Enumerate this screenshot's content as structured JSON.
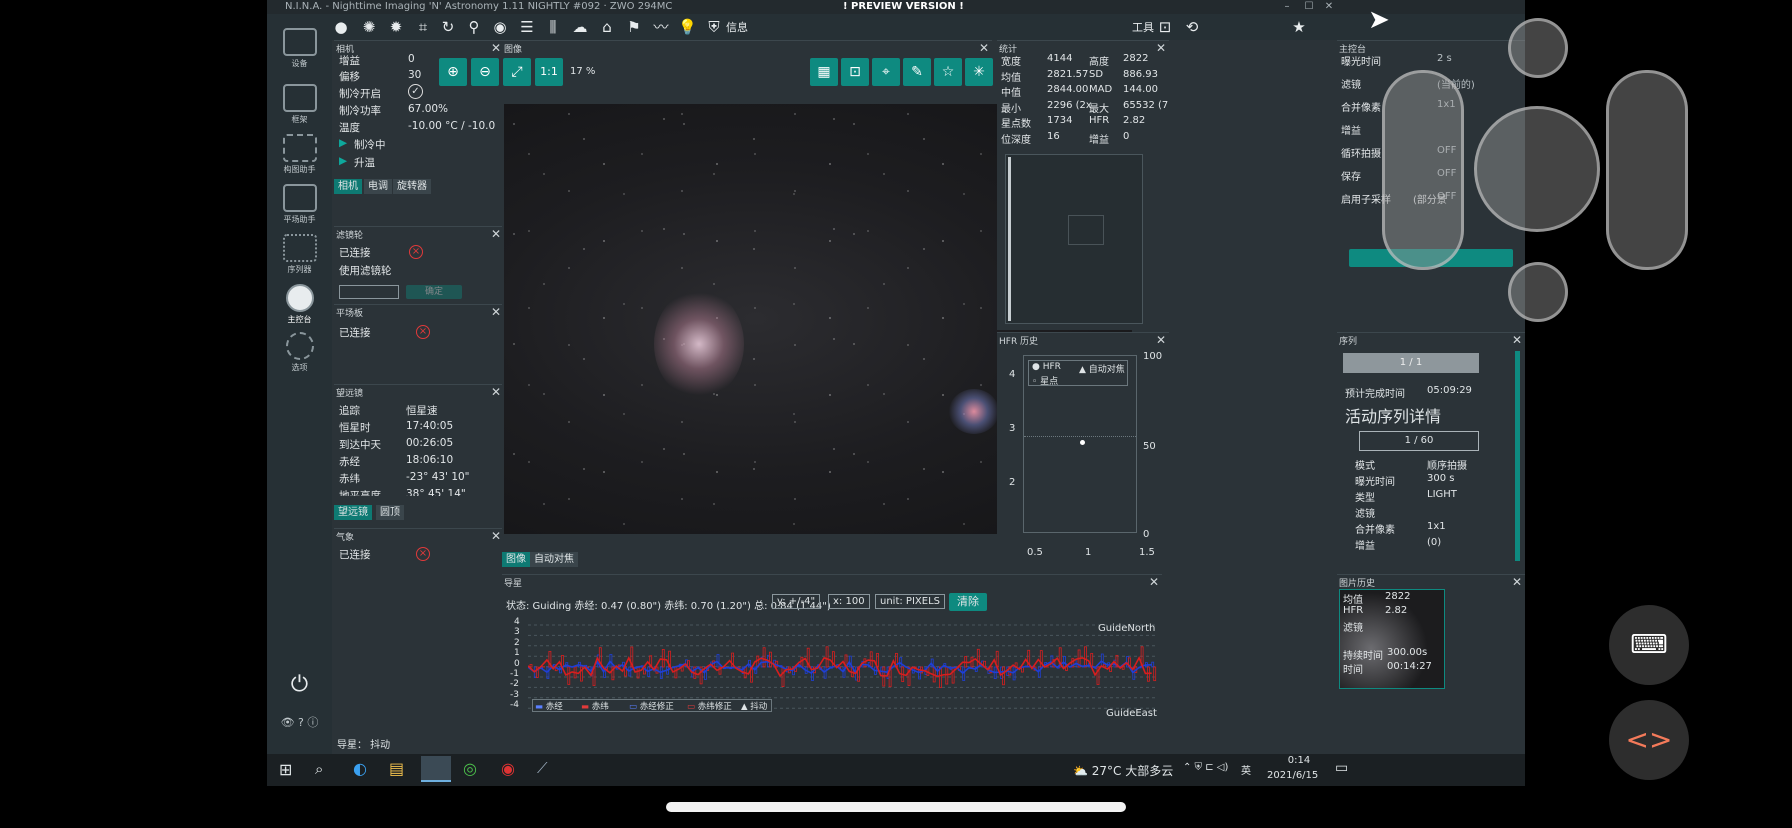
{
  "window": {
    "title": "N.I.N.A. - Nighttime Imaging 'N' Astronomy 1.11 NIGHTLY #092 · ZWO 294MC",
    "preview": "! PREVIEW VERSION !"
  },
  "toolbar": {
    "info_label": "信息",
    "tools_label": "工具"
  },
  "sidebar": [
    {
      "label": "设备"
    },
    {
      "label": "框架"
    },
    {
      "label": "构图助手"
    },
    {
      "label": "平场助手"
    },
    {
      "label": "序列器"
    },
    {
      "label": "主控台"
    },
    {
      "label": "选项"
    }
  ],
  "camera": {
    "title": "相机",
    "rows": [
      {
        "k": "增益",
        "v": "0"
      },
      {
        "k": "偏移",
        "v": "30"
      },
      {
        "k": "制冷开启",
        "v": "✓"
      },
      {
        "k": "制冷功率",
        "v": "67.00%"
      },
      {
        "k": "温度",
        "v": "-10.00 °C / -10.0"
      }
    ],
    "cooling": "制冷中",
    "warming": "升温",
    "tabs": [
      "相机",
      "电调",
      "旋转器"
    ]
  },
  "filterwheel": {
    "title": "滤镜轮",
    "connected": "已连接",
    "use": "使用滤镜轮",
    "btn": "确定"
  },
  "flatpanel": {
    "title": "平场板",
    "connected": "已连接"
  },
  "telescope": {
    "title": "望远镜",
    "rows": [
      {
        "k": "追踪",
        "v": "恒星速"
      },
      {
        "k": "恒星时",
        "v": "17:40:05"
      },
      {
        "k": "到达中天",
        "v": "00:26:05"
      },
      {
        "k": "赤经",
        "v": "18:06:10"
      },
      {
        "k": "赤纬",
        "v": "-23° 43' 10\""
      },
      {
        "k": "地平高度",
        "v": "38° 45' 14\""
      }
    ],
    "tabs": [
      "望远镜",
      "圆顶"
    ]
  },
  "weather": {
    "title": "气象",
    "connected": "已连接"
  },
  "image": {
    "title": "图像",
    "zoom": "17 %",
    "one": "1:1",
    "tabs": [
      "图像",
      "自动对焦"
    ]
  },
  "stats": {
    "title": "统计",
    "rows": [
      [
        "宽度",
        "4144",
        "高度",
        "2822"
      ],
      [
        "均值",
        "2821.57",
        "SD",
        "886.93"
      ],
      [
        "中值",
        "2844.00",
        "MAD",
        "144.00"
      ],
      [
        "最小",
        "2296 (2x",
        "最大",
        "65532 (7"
      ],
      [
        "星点数",
        "1734",
        "HFR",
        "2.82"
      ],
      [
        "位深度",
        "16",
        "增益",
        "0"
      ]
    ]
  },
  "imaging": {
    "title": "主控台",
    "rows": [
      {
        "k": "曝光时间",
        "v": "2 s"
      },
      {
        "k": "滤镜",
        "v": "(当前的)"
      },
      {
        "k": "合并像素",
        "v": "1x1"
      },
      {
        "k": "增益",
        "v": ""
      },
      {
        "k": "循环拍摄",
        "v": "OFF"
      },
      {
        "k": "保存",
        "v": "OFF"
      },
      {
        "k": "启用子采样",
        "v": "OFF"
      }
    ],
    "subsample_note": "(部分景"
  },
  "hfr": {
    "title": "HFR 历史",
    "legend": [
      "HFR",
      "自动对焦",
      "星点"
    ],
    "y_left": [
      "4",
      "3",
      "2"
    ],
    "y_right": [
      "100",
      "50",
      "0"
    ],
    "x": [
      "0.5",
      "1",
      "1.5"
    ]
  },
  "sequence": {
    "title": "序列",
    "progress": "1 / 1",
    "eta_label": "预计完成时间",
    "eta": "05:09:29",
    "detail_title": "活动序列详情",
    "count": "1 / 60",
    "rows": [
      {
        "k": "模式",
        "v": "顺序拍摄"
      },
      {
        "k": "曝光时间",
        "v": "300 s"
      },
      {
        "k": "类型",
        "v": "LIGHT"
      },
      {
        "k": "滤镜",
        "v": ""
      },
      {
        "k": "合并像素",
        "v": "1x1"
      },
      {
        "k": "增益",
        "v": "(0)"
      }
    ]
  },
  "guider": {
    "title": "导星",
    "status": "状态: Guiding 赤经: 0.47 (0.80\") 赤纬: 0.70 (1.20\") 总: 0.84 (1.44\")",
    "y_select": "y: +/-4\"",
    "x_select": "x: 100",
    "unit_select": "unit: PIXELS",
    "clear": "清除",
    "y_ticks": [
      "4",
      "3",
      "2",
      "1",
      "0",
      "-1",
      "-2",
      "-3",
      "-4"
    ],
    "north": "GuideNorth",
    "east": "GuideEast",
    "legend": [
      "赤经",
      "赤纬",
      "赤经修正",
      "赤纬修正",
      "抖动"
    ],
    "status_bar": "导星： 抖动"
  },
  "image_history": {
    "title": "图片历史",
    "rows": [
      [
        "均值",
        "2822"
      ],
      [
        "HFR",
        "2.82"
      ],
      [
        "滤镜",
        ""
      ],
      [
        "持续时间",
        "300.00s"
      ],
      [
        "时间",
        "00:14:27"
      ]
    ]
  },
  "taskbar": {
    "weather": "27°C 大部多云",
    "ime": "英",
    "time": "0:14",
    "date": "2021/6/15"
  },
  "colors": {
    "accent": "#0e8a80",
    "ra": "#1e3fd6",
    "dec": "#d81e1e"
  }
}
